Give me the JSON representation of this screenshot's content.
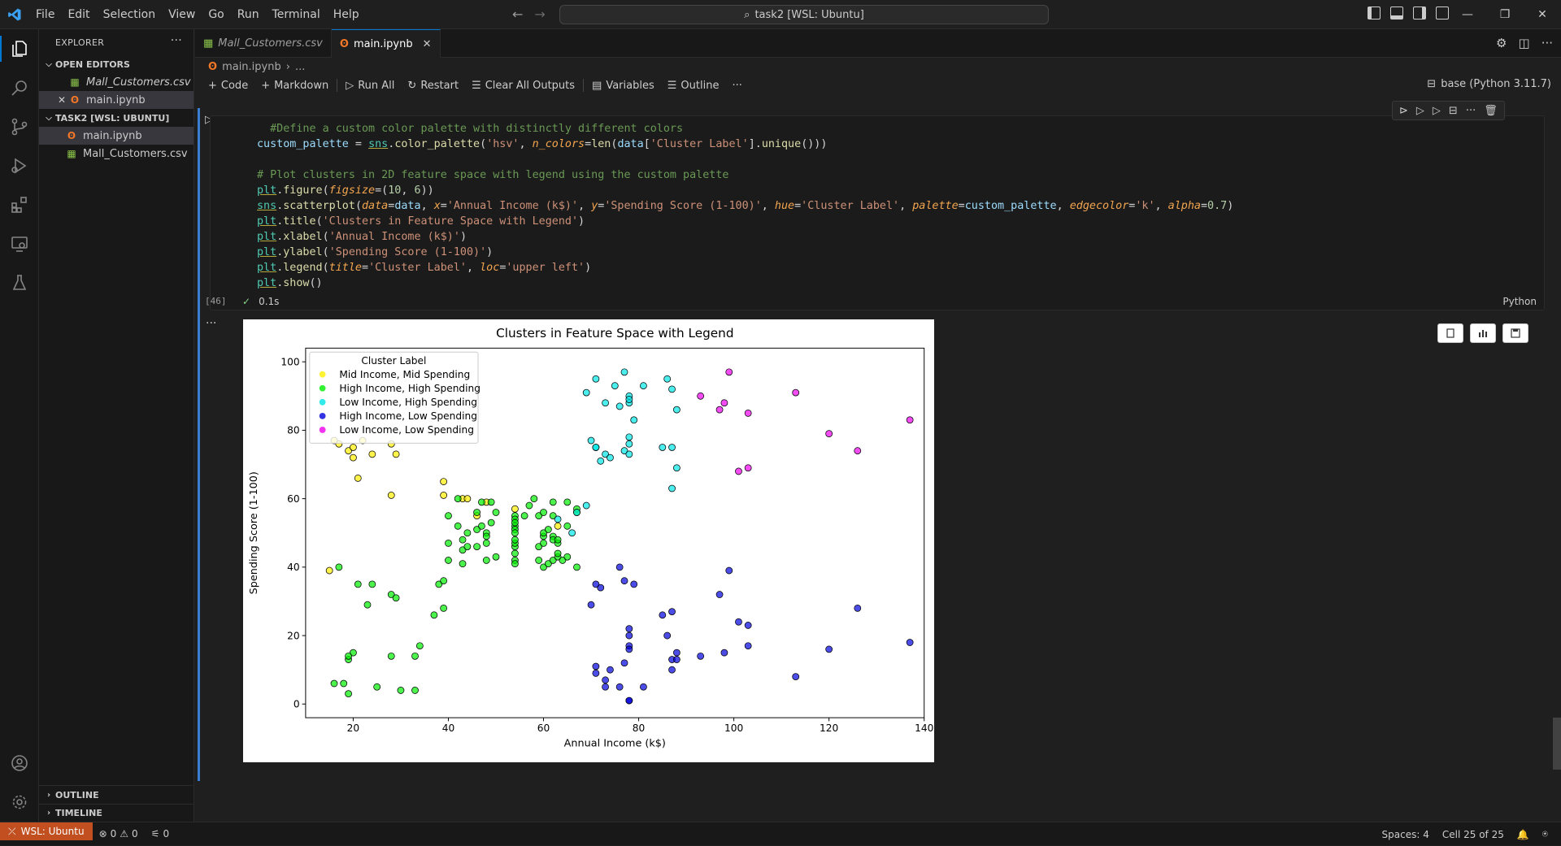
{
  "menu": [
    "File",
    "Edit",
    "Selection",
    "View",
    "Go",
    "Run",
    "Terminal",
    "Help"
  ],
  "command_center": "task2 [WSL: Ubuntu]",
  "sidebar": {
    "title": "EXPLORER",
    "open_editors_label": "OPEN EDITORS",
    "open_editors": [
      {
        "name": "Mall_Customers.csv",
        "type": "csv"
      },
      {
        "name": "main.ipynb",
        "type": "notebook"
      }
    ],
    "workspace_label": "TASK2 [WSL: UBUNTU]",
    "workspace_files": [
      {
        "name": "main.ipynb",
        "type": "notebook"
      },
      {
        "name": "Mall_Customers.csv",
        "type": "csv"
      }
    ],
    "outline_label": "OUTLINE",
    "timeline_label": "TIMELINE"
  },
  "tabs": [
    {
      "label": "Mall_Customers.csv",
      "type": "csv",
      "active": false
    },
    {
      "label": "main.ipynb",
      "type": "notebook",
      "active": true
    }
  ],
  "breadcrumb": {
    "file": "main.ipynb",
    "rest": "..."
  },
  "toolbar": {
    "code": "Code",
    "markdown": "Markdown",
    "run_all": "Run All",
    "restart": "Restart",
    "clear_all_outputs": "Clear All Outputs",
    "variables": "Variables",
    "outline": "Outline",
    "kernel": "base (Python 3.11.7)"
  },
  "cell": {
    "exec_count": "[46]",
    "duration": "0.1s",
    "language": "Python"
  },
  "status": {
    "remote": "WSL: Ubuntu",
    "errors": "0",
    "warnings": "0",
    "ports": "0",
    "spaces": "Spaces: 4",
    "cell_pos": "Cell 25 of 25"
  },
  "colors": {
    "accent": "#0078d4",
    "remote_bg": "#c14f1f"
  },
  "chart_data": {
    "type": "scatter",
    "title": "Clusters in Feature Space with Legend",
    "xlabel": "Annual Income (k$)",
    "ylabel": "Spending Score (1-100)",
    "xlim": [
      10,
      140
    ],
    "ylim": [
      -4,
      104
    ],
    "xticks": [
      20,
      40,
      60,
      80,
      100,
      120,
      140
    ],
    "yticks": [
      0,
      20,
      40,
      60,
      80,
      100
    ],
    "legend_title": "Cluster Label",
    "legend_location": "upper left",
    "series": [
      {
        "name": "Mid Income, Mid Spending",
        "color": "#ffee00",
        "points": [
          [
            15,
            39
          ],
          [
            20,
            72
          ],
          [
            21,
            66
          ],
          [
            28,
            61
          ],
          [
            39,
            61
          ],
          [
            39,
            65
          ],
          [
            43,
            60
          ],
          [
            44,
            60
          ],
          [
            46,
            55
          ],
          [
            48,
            59
          ],
          [
            54,
            57
          ],
          [
            63,
            52
          ],
          [
            19,
            74
          ],
          [
            20,
            75
          ],
          [
            17,
            76
          ],
          [
            24,
            73
          ],
          [
            29,
            73
          ],
          [
            16,
            77
          ],
          [
            28,
            76
          ],
          [
            22,
            77
          ]
        ]
      },
      {
        "name": "High Income, High Spending",
        "color": "#00ee00",
        "points": [
          [
            17,
            40
          ],
          [
            19,
            13
          ],
          [
            20,
            15
          ],
          [
            21,
            35
          ],
          [
            23,
            29
          ],
          [
            24,
            35
          ],
          [
            28,
            32
          ],
          [
            29,
            31
          ],
          [
            19,
            14
          ],
          [
            25,
            5
          ],
          [
            16,
            6
          ],
          [
            18,
            6
          ],
          [
            19,
            3
          ],
          [
            30,
            4
          ],
          [
            33,
            4
          ],
          [
            28,
            14
          ],
          [
            33,
            14
          ],
          [
            34,
            17
          ],
          [
            37,
            26
          ],
          [
            38,
            35
          ],
          [
            39,
            36
          ],
          [
            39,
            28
          ],
          [
            40,
            42
          ],
          [
            40,
            47
          ],
          [
            40,
            55
          ],
          [
            42,
            52
          ],
          [
            42,
            60
          ],
          [
            43,
            45
          ],
          [
            43,
            48
          ],
          [
            43,
            41
          ],
          [
            44,
            50
          ],
          [
            44,
            46
          ],
          [
            46,
            51
          ],
          [
            46,
            56
          ],
          [
            46,
            46
          ],
          [
            47,
            52
          ],
          [
            47,
            59
          ],
          [
            48,
            50
          ],
          [
            48,
            47
          ],
          [
            48,
            42
          ],
          [
            48,
            49
          ],
          [
            49,
            53
          ],
          [
            49,
            59
          ],
          [
            50,
            43
          ],
          [
            50,
            56
          ],
          [
            54,
            46
          ],
          [
            54,
            55
          ],
          [
            54,
            52
          ],
          [
            54,
            51
          ],
          [
            54,
            47
          ],
          [
            54,
            54
          ],
          [
            54,
            48
          ],
          [
            54,
            42
          ],
          [
            54,
            41
          ],
          [
            54,
            44
          ],
          [
            54,
            53
          ],
          [
            54,
            50
          ],
          [
            56,
            55
          ],
          [
            57,
            58
          ],
          [
            58,
            60
          ],
          [
            59,
            55
          ],
          [
            59,
            46
          ],
          [
            59,
            42
          ],
          [
            60,
            49
          ],
          [
            60,
            56
          ],
          [
            60,
            47
          ],
          [
            60,
            50
          ],
          [
            60,
            40
          ],
          [
            61,
            41
          ],
          [
            62,
            42
          ],
          [
            62,
            59
          ],
          [
            62,
            55
          ],
          [
            62,
            49
          ],
          [
            62,
            48
          ],
          [
            63,
            43
          ],
          [
            63,
            47
          ],
          [
            63,
            44
          ],
          [
            64,
            42
          ],
          [
            65,
            52
          ],
          [
            65,
            59
          ],
          [
            65,
            43
          ],
          [
            67,
            57
          ],
          [
            67,
            56
          ],
          [
            67,
            40
          ],
          [
            63,
            48
          ],
          [
            61,
            51
          ]
        ]
      },
      {
        "name": "Low Income, High Spending",
        "color": "#00e5e5",
        "points": [
          [
            69,
            91
          ],
          [
            70,
            77
          ],
          [
            71,
            95
          ],
          [
            71,
            75
          ],
          [
            71,
            75
          ],
          [
            72,
            71
          ],
          [
            73,
            88
          ],
          [
            73,
            73
          ],
          [
            74,
            72
          ],
          [
            75,
            93
          ],
          [
            76,
            87
          ],
          [
            77,
            97
          ],
          [
            77,
            74
          ],
          [
            78,
            90
          ],
          [
            78,
            88
          ],
          [
            78,
            76
          ],
          [
            78,
            89
          ],
          [
            78,
            78
          ],
          [
            78,
            73
          ],
          [
            79,
            83
          ],
          [
            81,
            93
          ],
          [
            85,
            75
          ],
          [
            86,
            95
          ],
          [
            87,
            63
          ],
          [
            87,
            75
          ],
          [
            87,
            92
          ],
          [
            88,
            86
          ],
          [
            88,
            69
          ],
          [
            63,
            54
          ],
          [
            66,
            50
          ],
          [
            67,
            56
          ],
          [
            69,
            58
          ]
        ]
      },
      {
        "name": "High Income, Low Spending",
        "color": "#0000dd",
        "points": [
          [
            70,
            29
          ],
          [
            71,
            11
          ],
          [
            71,
            9
          ],
          [
            72,
            34
          ],
          [
            73,
            5
          ],
          [
            73,
            7
          ],
          [
            74,
            10
          ],
          [
            76,
            40
          ],
          [
            76,
            5
          ],
          [
            77,
            12
          ],
          [
            77,
            36
          ],
          [
            78,
            22
          ],
          [
            78,
            17
          ],
          [
            78,
            20
          ],
          [
            78,
            16
          ],
          [
            78,
            1
          ],
          [
            78,
            1
          ],
          [
            79,
            35
          ],
          [
            81,
            5
          ],
          [
            85,
            26
          ],
          [
            86,
            20
          ],
          [
            87,
            27
          ],
          [
            87,
            13
          ],
          [
            87,
            10
          ],
          [
            88,
            13
          ],
          [
            88,
            15
          ],
          [
            93,
            14
          ],
          [
            97,
            32
          ],
          [
            98,
            15
          ],
          [
            99,
            39
          ],
          [
            101,
            24
          ],
          [
            103,
            17
          ],
          [
            103,
            23
          ],
          [
            113,
            8
          ],
          [
            120,
            16
          ],
          [
            126,
            28
          ],
          [
            137,
            18
          ],
          [
            71,
            35
          ]
        ]
      },
      {
        "name": "Low Income, Low Spending",
        "color": "#ee00ee",
        "points": [
          [
            93,
            90
          ],
          [
            97,
            86
          ],
          [
            98,
            88
          ],
          [
            99,
            97
          ],
          [
            101,
            68
          ],
          [
            103,
            85
          ],
          [
            103,
            69
          ],
          [
            113,
            91
          ],
          [
            120,
            79
          ],
          [
            126,
            74
          ],
          [
            137,
            83
          ]
        ]
      }
    ]
  }
}
